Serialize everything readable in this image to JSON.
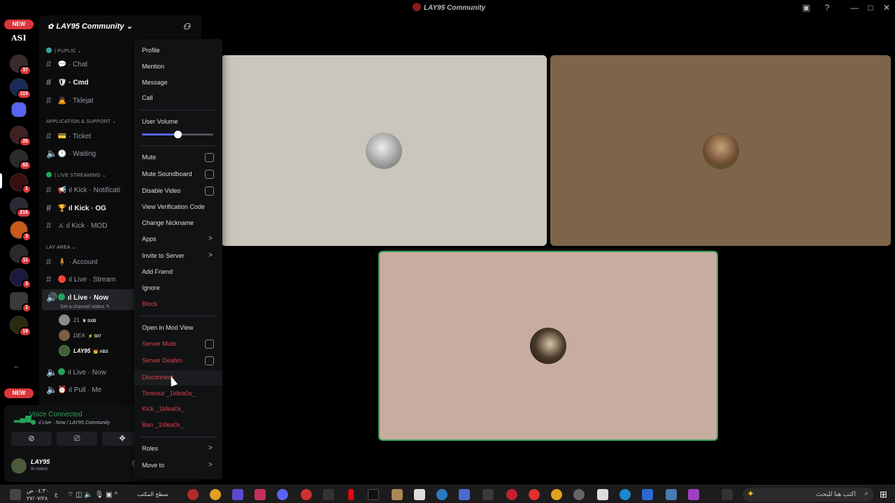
{
  "window": {
    "title": "LAY95 Community",
    "controls": [
      "▣",
      "?",
      "—",
      "□",
      "✕"
    ]
  },
  "rail": {
    "new_top": "NEW",
    "new_bottom": "NEW",
    "top_label": "ASI",
    "more": "--",
    "servers": [
      {
        "count": "1"
      },
      {
        "count": "37"
      },
      {
        "count": "119"
      },
      {
        "count": ""
      },
      {
        "count": "20"
      },
      {
        "count": "62"
      },
      {
        "count": "1"
      },
      {
        "count": "218"
      },
      {
        "count": "3"
      },
      {
        "count": "11"
      },
      {
        "count": "3"
      },
      {
        "count": "1"
      },
      {
        "count": "19"
      }
    ]
  },
  "server": {
    "name": "LAY95 Community",
    "chevron": "⌄",
    "invite_icon": "person-add-icon"
  },
  "categories": {
    "public": "| PUPLIC",
    "app_support": "APPLICATION & SUPPORT",
    "live_streaming": "| LIVE STREAMING",
    "lay_area": "LAY AREA"
  },
  "channels": {
    "chat": "· Chat",
    "cmd": "· Cmd",
    "tklejat": "· Tklejat",
    "ticket": "· Ticket",
    "waiting": "· Waiting",
    "kick_notif": "ıl Kick · Notificati",
    "kick_og": "ıl Kick · OG",
    "kick_mod": "ıl Kick · MOD",
    "account": "· Account",
    "live_stream": "ıl Live · Stream",
    "live_now": "ıl Live · Now",
    "live_now_status": "Set a channel status ✎",
    "live_now_2": "ıl Live · Now",
    "pull_me": "ıl Pull · Me"
  },
  "voice_users": [
    {
      "name": "21",
      "tag": "♕ SXB"
    },
    {
      "name": "DEA",
      "tag": "⚡ 507"
    },
    {
      "name": "LAY95",
      "tag": "👑 ABS"
    }
  ],
  "voice_panel": {
    "title": "Voice Connected",
    "subtitle": "ıl Live · Now / LAY95 Community",
    "buttons": [
      "⊘",
      "⎚",
      "✥"
    ]
  },
  "user": {
    "name": "LAY95",
    "status": "In voice"
  },
  "context_menu": {
    "profile": "Profile",
    "mention": "Mention",
    "message": "Message",
    "call": "Call",
    "user_volume": "User Volume",
    "volume_level": 0.5,
    "mute": "Mute",
    "mute_soundboard": "Mute Soundboard",
    "disable_video": "Disable Video",
    "view_verification": "View Verification Code",
    "change_nickname": "Change Nickname",
    "apps": "Apps",
    "invite_to_server": "Invite to Server",
    "add_friend": "Add Friend",
    "ignore": "Ignore",
    "block": "Block",
    "open_mod_view": "Open in Mod View",
    "server_mute": "Server Mute",
    "server_deafen": "Server Deafen",
    "disconnect": "Disconnect",
    "timeout": "Timeout _1ldea0x_",
    "kick": "Kick _1ldea0x_",
    "ban": "Ban _1ldea0x_",
    "roles": "Roles",
    "move_to": "Move to",
    "chevron": ">"
  },
  "tiles": {
    "colors": [
      "#c9c7bb",
      "#7e6549",
      "#c9aca0"
    ],
    "accent_speaking": "#3ba55c"
  },
  "taskbar": {
    "search_placeholder": "اكتب هنا للبحث",
    "desktop_label": "سطح المكتب",
    "time": "٠٤:٣٠ ص",
    "date": "٢٧/٠٧/٢٨",
    "lang": "ع"
  }
}
